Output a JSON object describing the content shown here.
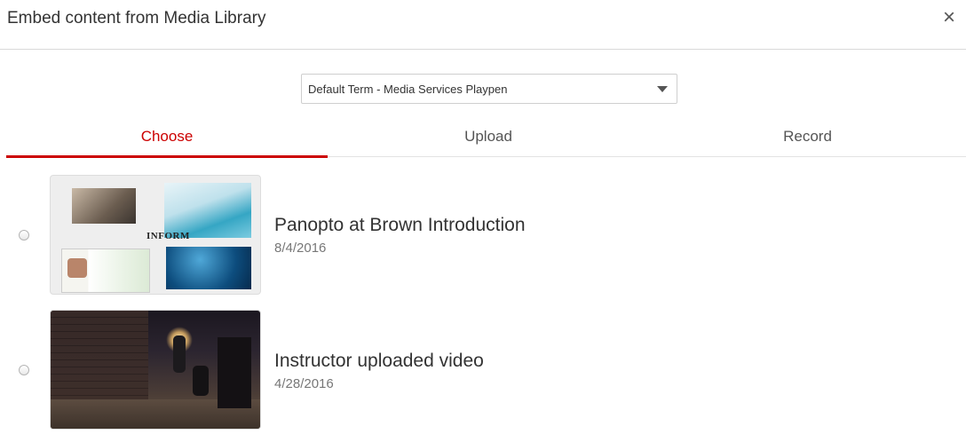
{
  "dialog": {
    "title": "Embed content from Media Library",
    "close_label": "×"
  },
  "folder_select": {
    "selected": "Default Term - Media Services Playpen"
  },
  "tabs": [
    {
      "label": "Choose",
      "active": true
    },
    {
      "label": "Upload",
      "active": false
    },
    {
      "label": "Record",
      "active": false
    }
  ],
  "media_items": [
    {
      "title": "Panopto at Brown Introduction",
      "date": "8/4/2016",
      "thumb_text": "Inform"
    },
    {
      "title": "Instructor uploaded video",
      "date": "4/28/2016"
    }
  ],
  "colors": {
    "accent": "#cc0000"
  }
}
